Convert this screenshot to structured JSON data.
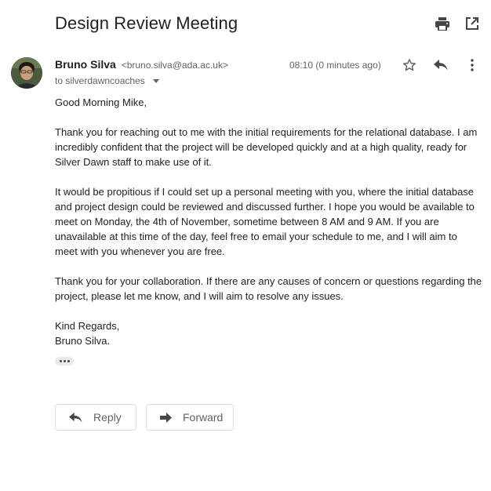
{
  "email": {
    "subject": "Design Review Meeting",
    "sender_name": "Bruno Silva",
    "sender_email": "<bruno.silva@ada.ac.uk>",
    "to_line": "to silverdawncoaches",
    "timestamp": "08:10 (0 minutes ago)",
    "body": {
      "greeting": "Good Morning Mike,",
      "paragraph_1": "Thank you for reaching out to me with the initial requirements for the relational database. I am incredibly confident that the project will be developed quickly and at a high quality, ready for Silver Dawn staff to make use of it.",
      "paragraph_2": "It would be propitious if I could set up a personal meeting with you, where the initial database and project design could be reviewed and discussed further. I hope you would be available to meet on Monday, the 4th of November, sometime between 8 AM and 9 AM. If you are unavailable at this time of the day, feel free to email your schedule to me, and I will aim to meet with you whenever you are free.",
      "paragraph_3": "Thank you for your collaboration. If there are any causes of concern or questions regarding the project, please let me know, and I will aim to resolve any issues.",
      "closing": "Kind Regards,",
      "signature": "Bruno Silva."
    }
  },
  "actions": {
    "reply_label": "Reply",
    "forward_label": "Forward"
  },
  "icons": {
    "print": "print-icon",
    "open_new_window": "open-in-new-window-icon",
    "star": "star-outline-icon",
    "reply": "reply-icon",
    "more": "more-vertical-icon",
    "forward": "forward-icon"
  },
  "colors": {
    "icon": "#5f6368",
    "dark_icon": "#444746",
    "text": "#222222",
    "muted": "#5f6368",
    "border": "#dadce0"
  }
}
